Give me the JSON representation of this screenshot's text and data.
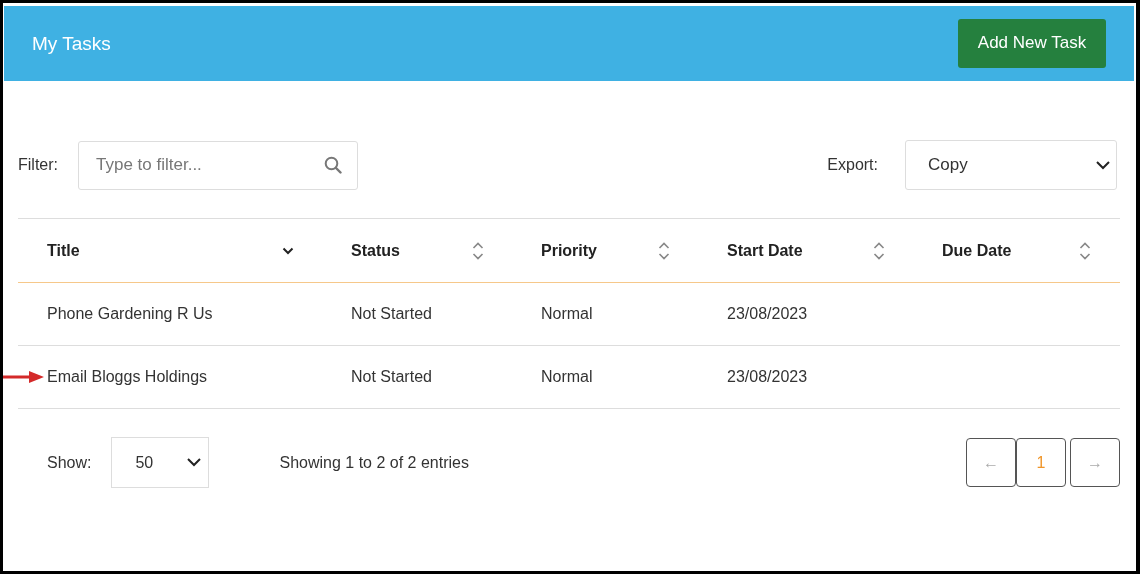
{
  "header": {
    "title": "My Tasks",
    "button": "Add New Task"
  },
  "filter": {
    "label": "Filter:",
    "placeholder": "Type to filter..."
  },
  "export": {
    "label": "Export:",
    "value": "Copy"
  },
  "table": {
    "columns": [
      {
        "label": "Title",
        "kind": "sorted_desc"
      },
      {
        "label": "Status",
        "kind": "sortable"
      },
      {
        "label": "Priority",
        "kind": "sortable"
      },
      {
        "label": "Start Date",
        "kind": "sortable"
      },
      {
        "label": "Due Date",
        "kind": "sortable"
      }
    ],
    "rows": [
      {
        "cells": [
          "Phone Gardening R Us",
          "Not Started",
          "Normal",
          "23/08/2023",
          ""
        ],
        "marked": false
      },
      {
        "cells": [
          "Email Bloggs Holdings",
          "Not Started",
          "Normal",
          "23/08/2023",
          ""
        ],
        "marked": true
      }
    ]
  },
  "footer": {
    "show_label": "Show:",
    "page_size": "50",
    "summary": "Showing 1 to 2 of 2 entries"
  },
  "pagination": [
    {
      "label": "←",
      "kind": "prev",
      "disabled": true,
      "selected": false
    },
    {
      "label": "1",
      "kind": "page",
      "disabled": false,
      "selected": true
    },
    {
      "label": "→",
      "kind": "next",
      "disabled": true,
      "selected": false
    }
  ]
}
